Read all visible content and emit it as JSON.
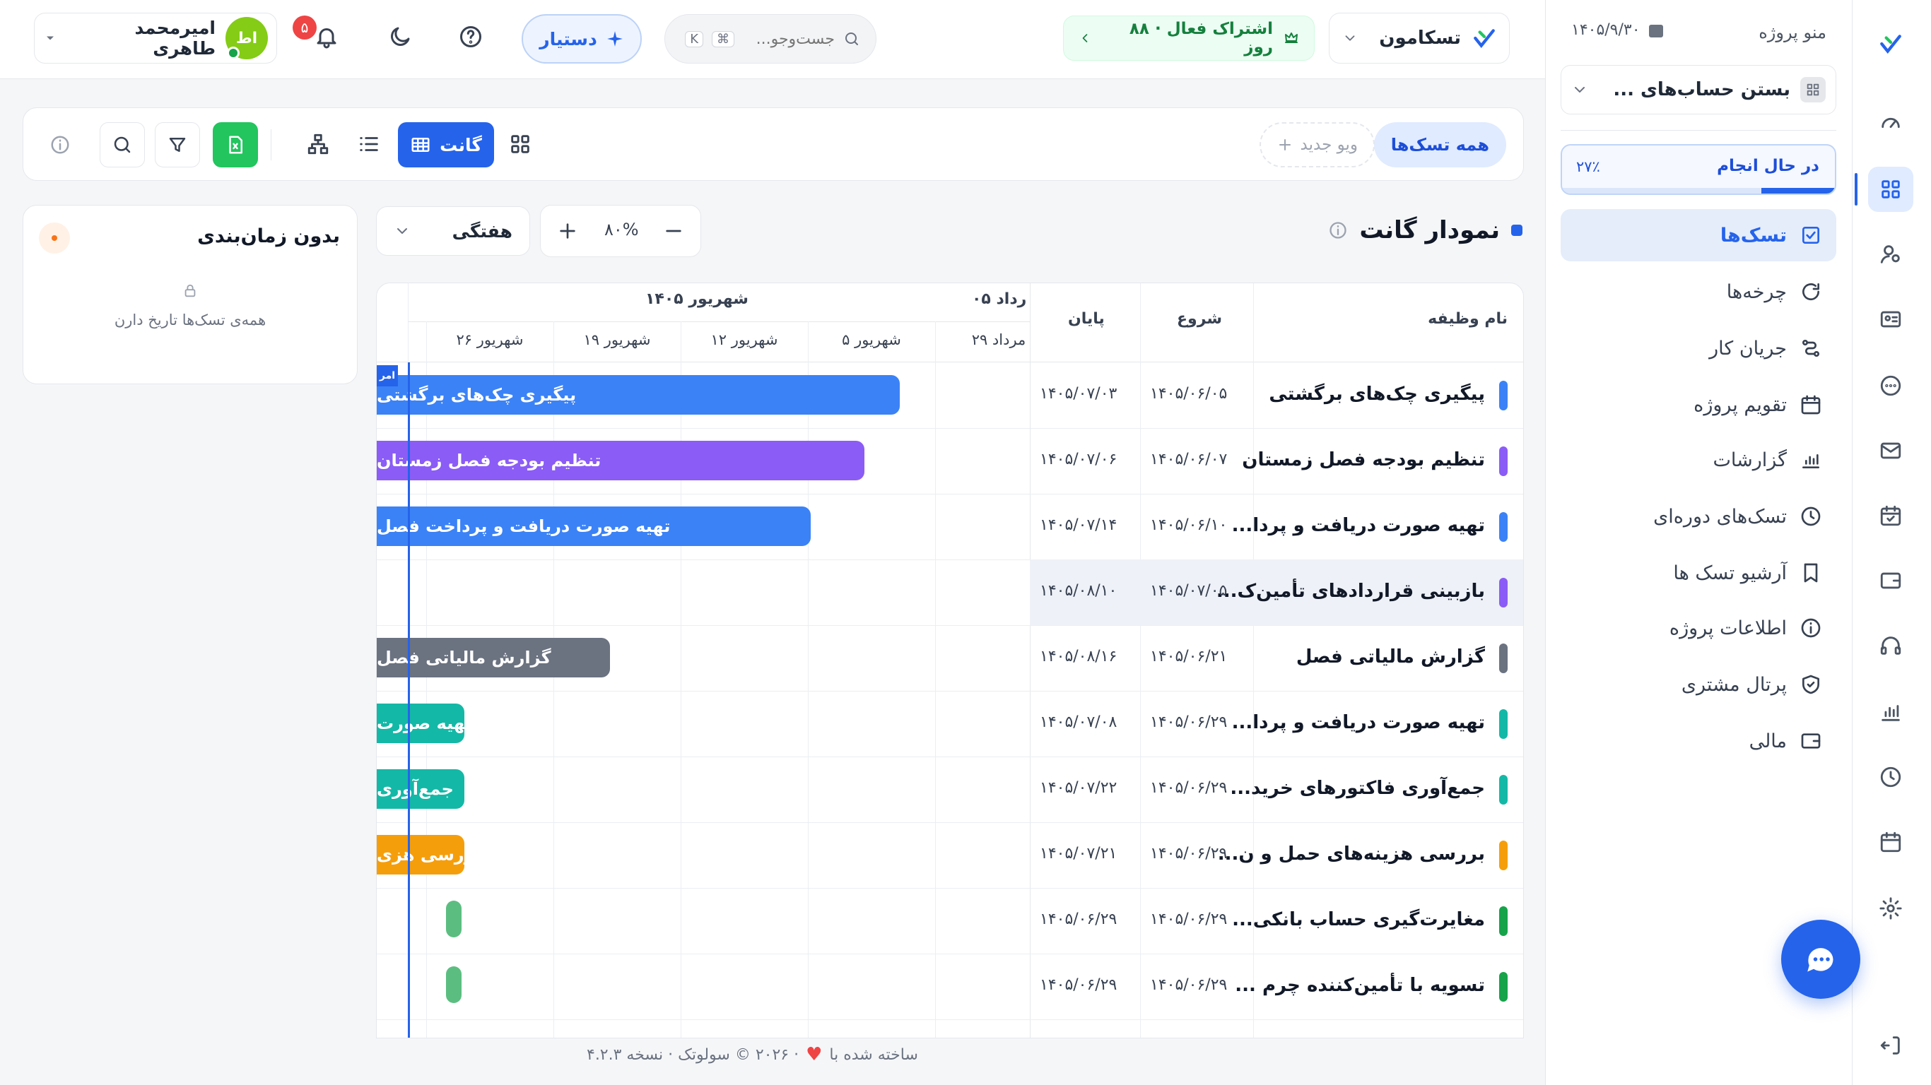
{
  "app": {
    "workspace_name": "تسکامون",
    "subscription": "اشتراک فعال · ۸۸ روز",
    "search_placeholder": "جست‌وجو...",
    "search_shortcut_cmd": "⌘",
    "search_shortcut_key": "K",
    "assistant_label": "دستیار",
    "notification_count": "۵",
    "user_initials": "اط",
    "user_name": "امیرمحمد طاهری",
    "colors": {
      "accent": "#2563eb",
      "success": "#22c55e",
      "danger": "#ef4444"
    }
  },
  "panel": {
    "title": "منو پروژه",
    "date": "۱۴۰۵/۹/۳۰",
    "project_name": "بستن حساب‌های ...",
    "status_label": "در حال انجام",
    "status_percent": "۲۷٪",
    "progress": 0.27,
    "nav": [
      {
        "label": "تسک‌ها",
        "icon": "checkbox-icon"
      },
      {
        "label": "چرخه‌ها",
        "icon": "cycle-icon"
      },
      {
        "label": "جریان کار",
        "icon": "workflow-icon"
      },
      {
        "label": "تقویم پروژه",
        "icon": "calendar-icon"
      },
      {
        "label": "گزارشات",
        "icon": "chart-icon"
      },
      {
        "label": "تسک‌های دوره‌ای",
        "icon": "clock-icon"
      },
      {
        "label": "آرشیو تسک ها",
        "icon": "archive-icon"
      },
      {
        "label": "اطلاعات پروژه",
        "icon": "info-icon"
      },
      {
        "label": "پرتال مشتری",
        "icon": "shield-icon"
      },
      {
        "label": "مالی",
        "icon": "wallet-icon"
      }
    ]
  },
  "toolbar": {
    "all_tasks": "همه تسک‌ها",
    "new_view": "ویو جدید",
    "gantt_label": "گانت"
  },
  "gantt": {
    "title": "نمودار گانت",
    "zoom": "۸۰%",
    "scale": "هفتگی",
    "unscheduled_title": "بدون زمان‌بندی",
    "unscheduled_text": "همه‌ی تسک‌ها تاریخ دارن",
    "col_name": "نام وظیفه",
    "col_start": "شروع",
    "col_end": "پایان",
    "month_1": "شهریور ۱۴۰۵",
    "month_2": "رداد ۰۵",
    "weeks": [
      "۲۹ مرداد",
      "۵ شهریور",
      "۱۲ شهریور",
      "۱۹ شهریور",
      "۲۶ شهریور"
    ],
    "today_label": "امر",
    "rows": [
      {
        "name": "پیگیری چک‌های برگشتی",
        "start": "۱۴۰۵/۰۶/۰۵",
        "end": "۱۴۰۵/۰۷/۰۳",
        "color": "#3b82f6",
        "bar": "پیگیری چک‌های برگشتی"
      },
      {
        "name": "تنظیم بودجه فصل زمستان",
        "start": "۱۴۰۵/۰۶/۰۷",
        "end": "۱۴۰۵/۰۷/۰۶",
        "color": "#8b5cf6",
        "bar": "تنظیم بودجه فصل زمستان"
      },
      {
        "name": "تهیه صورت دریافت و پردا...",
        "start": "۱۴۰۵/۰۶/۱۰",
        "end": "۱۴۰۵/۰۷/۱۴",
        "color": "#3b82f6",
        "bar": "تهیه صورت دریافت و پرداخت فصل"
      },
      {
        "name": "بازبینی قراردادهای تأمین‌ک...",
        "start": "۱۴۰۵/۰۷/۰۵",
        "end": "۱۴۰۵/۰۸/۱۰",
        "color": "#8b5cf6",
        "bar": ""
      },
      {
        "name": "گزارش مالیاتی فصل",
        "start": "۱۴۰۵/۰۶/۲۱",
        "end": "۱۴۰۵/۰۸/۱۶",
        "color": "#6b7280",
        "bar": "گزارش مالیاتی فصل"
      },
      {
        "name": "تهیه صورت دریافت و پردا...",
        "start": "۱۴۰۵/۰۶/۲۹",
        "end": "۱۴۰۵/۰۷/۰۸",
        "color": "#14b8a6",
        "bar": "تهیه صورت"
      },
      {
        "name": "جمع‌آوری فاکتورهای خرید...",
        "start": "۱۴۰۵/۰۶/۲۹",
        "end": "۱۴۰۵/۰۷/۲۲",
        "color": "#14b8a6",
        "bar": "جمع‌آوری"
      },
      {
        "name": "بررسی هزینه‌های حمل و ن...",
        "start": "۱۴۰۵/۰۶/۲۹",
        "end": "۱۴۰۵/۰۷/۲۱",
        "color": "#f59e0b",
        "bar": "بررسی هزی"
      },
      {
        "name": "مغایرت‌گیری حساب بانکی...",
        "start": "۱۴۰۵/۰۶/۲۹",
        "end": "۱۴۰۵/۰۶/۲۹",
        "color": "#16a34a",
        "bar": ""
      },
      {
        "name": "تسویه با تأمین‌کننده چرم ...",
        "start": "۱۴۰۵/۰۶/۲۹",
        "end": "۱۴۰۵/۰۶/۲۹",
        "color": "#16a34a",
        "bar": ""
      }
    ]
  },
  "footer": {
    "made_with": "ساخته شده با",
    "credit": "· ۲۰۲۶ © سولوتک · نسخه ۴.۲.۳"
  }
}
